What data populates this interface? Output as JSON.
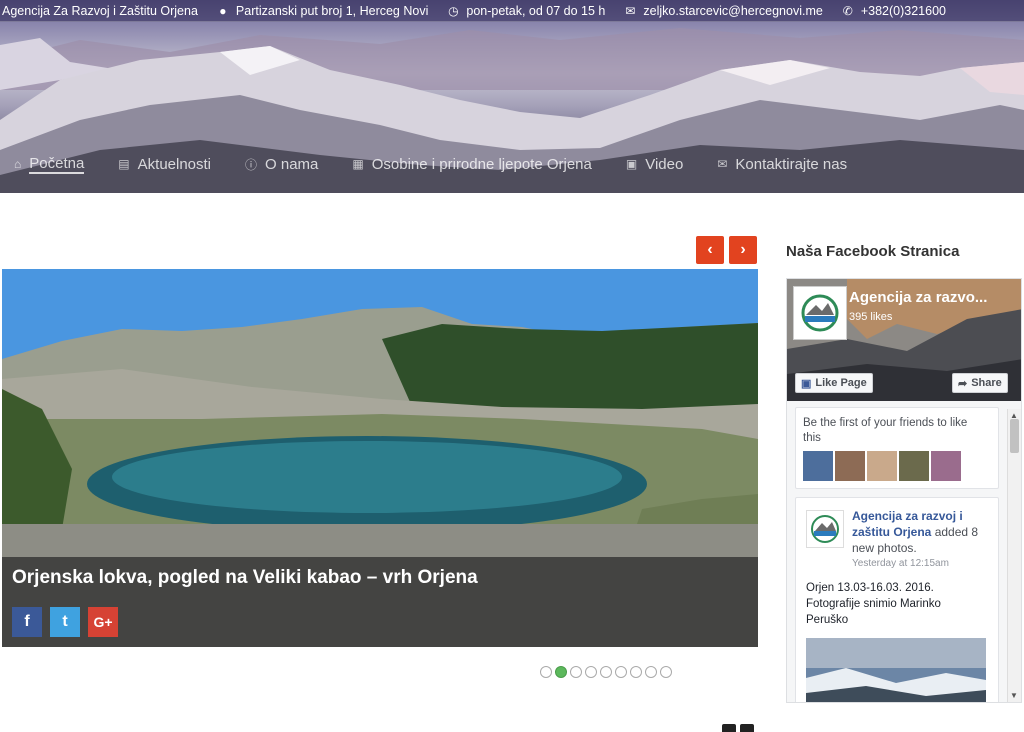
{
  "topbar": {
    "agency": "Agencija Za Razvoj i Zaštitu Orjena",
    "address": "Partizanski put broj 1, Herceg Novi",
    "hours": "pon-petak, od 07 do 15 h",
    "email": "zeljko.starcevic@hercegnovi.me",
    "phone": "+382(0)321600",
    "icons": [
      "map-pin-icon",
      "clock-icon",
      "envelope-icon",
      "phone-icon"
    ]
  },
  "nav": {
    "items": [
      {
        "label": "Početna",
        "icon": "home-icon"
      },
      {
        "label": "Aktuelnosti",
        "icon": "newspaper-icon"
      },
      {
        "label": "O nama",
        "icon": "info-icon"
      },
      {
        "label": "Osobine i prirodne ljepote Orjena",
        "icon": "book-icon"
      },
      {
        "label": "Video",
        "icon": "video-icon"
      },
      {
        "label": "Kontaktirajte nas",
        "icon": "envelope-icon"
      }
    ]
  },
  "slider": {
    "prev_label": "‹",
    "next_label": "›",
    "caption": "Orjenska lokva, pogled na Veliki kabao – vrh Orjena",
    "share": {
      "facebook": "f",
      "twitter": "t",
      "google": "G+"
    },
    "current_slide": 2,
    "total_slides": 9,
    "colors": {
      "arrow": "#e2431f",
      "active_dot": "#5cb85c",
      "facebook": "#3b5998",
      "twitter": "#3fa2e0",
      "google": "#d64234"
    }
  },
  "sidebar": {
    "title": "Naša Facebook Stranica",
    "fb": {
      "page_name": "Agencija za razvo...",
      "likes": "395 likes",
      "like_button": "Like Page",
      "share_button": "Share",
      "friends_text": "Be the first of your friends to like this",
      "post": {
        "author": "Agencija za razvoj i zaštitu Orjena",
        "action": "added 8 new photos.",
        "time": "Yesterday at 12:15am",
        "text": "Orjen 13.03-16.03. 2016. Fotografije snimio Marinko Peruško"
      }
    }
  }
}
